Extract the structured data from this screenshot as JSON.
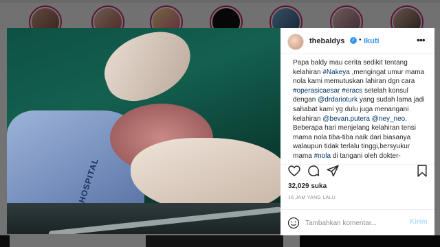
{
  "post": {
    "username": "thebaldys",
    "separator": "•",
    "follow_label": "Ikuti",
    "more_label": "•••",
    "caption": [
      {
        "t": "Papa baldy mau cerita sedikit tentang kelahiran "
      },
      {
        "t": "#Nakeya",
        "tag": true
      },
      {
        "t": " ,mengingat umur mama nola kami memutuskan lahiran dgn cara "
      },
      {
        "t": "#operasicaesar",
        "tag": true
      },
      {
        "t": " "
      },
      {
        "t": "#eracs",
        "tag": true
      },
      {
        "t": " setelah konsul dengan "
      },
      {
        "t": "@drdarioturk",
        "tag": true
      },
      {
        "t": " yang sudah lama jadi sahabat kami yg dulu juga menangani kelahiran "
      },
      {
        "t": "@bevan.putera",
        "tag": true
      },
      {
        "t": " "
      },
      {
        "t": "@ney_neo",
        "tag": true
      },
      {
        "t": ". Beberapa hari menjelang kelahiran tensi mama nola tiba-tiba naik dari biasanya walaupun tidak terlalu tinggi,bersyukur mama "
      },
      {
        "t": "#nola",
        "tag": true
      },
      {
        "t": " di tangani oleh dokter-"
      }
    ],
    "likes": "32,029 suka",
    "time": "16 JAM YANG LALU",
    "comment_placeholder": "Tambahkan komentar...",
    "post_label": "Kirim",
    "image_text": "HOSPITAL"
  },
  "icons": {
    "like": "heart-icon",
    "comment": "comment-icon",
    "share": "share-icon",
    "save": "bookmark-icon",
    "emoji": "smile-icon",
    "tag": "person-tag-icon"
  },
  "colors": {
    "link": "#003569",
    "accent": "#3897f0",
    "post_disabled": "#b2dffc",
    "muted": "#8e8e8e"
  }
}
